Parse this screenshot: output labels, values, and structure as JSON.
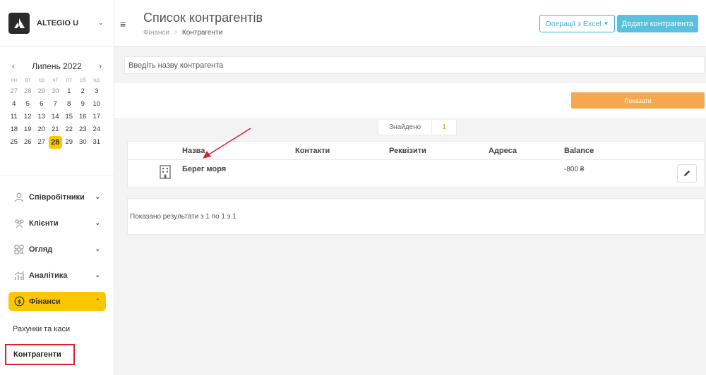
{
  "app": {
    "name": "ALTEGIO U"
  },
  "calendar": {
    "month_label": "Липень 2022",
    "weekdays": [
      "пн",
      "вт",
      "ср",
      "чт",
      "пт",
      "сб",
      "нд"
    ],
    "days": [
      [
        {
          "d": "27",
          "m": 1
        },
        {
          "d": "28",
          "m": 1
        },
        {
          "d": "29",
          "m": 1
        },
        {
          "d": "30",
          "m": 1
        },
        {
          "d": "1"
        },
        {
          "d": "2"
        },
        {
          "d": "3"
        }
      ],
      [
        {
          "d": "4"
        },
        {
          "d": "5"
        },
        {
          "d": "6"
        },
        {
          "d": "7"
        },
        {
          "d": "8"
        },
        {
          "d": "9"
        },
        {
          "d": "10"
        }
      ],
      [
        {
          "d": "11"
        },
        {
          "d": "12"
        },
        {
          "d": "13"
        },
        {
          "d": "14"
        },
        {
          "d": "15"
        },
        {
          "d": "16"
        },
        {
          "d": "17"
        }
      ],
      [
        {
          "d": "18"
        },
        {
          "d": "19"
        },
        {
          "d": "20"
        },
        {
          "d": "21"
        },
        {
          "d": "22"
        },
        {
          "d": "23"
        },
        {
          "d": "24"
        }
      ],
      [
        {
          "d": "25"
        },
        {
          "d": "26"
        },
        {
          "d": "27"
        },
        {
          "d": "28",
          "today": 1
        },
        {
          "d": "29"
        },
        {
          "d": "30"
        },
        {
          "d": "31"
        }
      ]
    ]
  },
  "menu": {
    "employees": "Співробітники",
    "clients": "Клієнти",
    "overview": "Огляд",
    "analytics": "Аналітика",
    "finance": "Фінанси",
    "finance_sub": {
      "accounts": "Рахунки та каси",
      "counterparties": "Контрагенти"
    }
  },
  "header": {
    "title": "Список контрагентів",
    "breadcrumb": [
      "Фінанси",
      "Контрагенти"
    ],
    "excel_button": "Операції з Excel",
    "add_button": "Додати контрагента"
  },
  "filters": {
    "search_placeholder": "Введіть назву контрагента",
    "show_button": "Показати"
  },
  "results": {
    "found_label": "Знайдено",
    "found_count": "1",
    "columns": [
      "Назва",
      "Контакти",
      "Реквізити",
      "Адреса",
      "Balance"
    ],
    "rows": [
      {
        "name": "Берег моря",
        "contacts": "",
        "details": "",
        "address": "",
        "balance": "-800 ₴"
      }
    ],
    "summary": "Показано результати з 1 по 1 з 1"
  },
  "colors": {
    "accent_yellow": "#fdc700",
    "accent_orange": "#f6a84f",
    "accent_blue": "#5bc0de",
    "annotation_red": "#d9232d"
  }
}
